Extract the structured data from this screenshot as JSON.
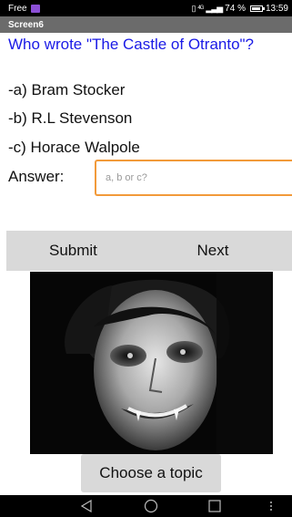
{
  "status_bar": {
    "carrier": "Free",
    "signal_text": "4G",
    "battery_percent": "74 %",
    "battery_level": 0.74,
    "time": "13:59"
  },
  "title_bar": {
    "title": "Screen6"
  },
  "quiz": {
    "question": "Who wrote \"The Castle of Otranto\"?",
    "options": [
      "-a) Bram Stocker",
      "-b) R.L Stevenson",
      "-c) Horace Walpole"
    ],
    "answer_label": "Answer:",
    "answer_placeholder": "a, b or c?",
    "answer_value": ""
  },
  "buttons": {
    "submit": "Submit",
    "next": "Next",
    "choose_topic": "Choose a topic"
  },
  "image": {
    "subject": "vampire-portrait"
  },
  "colors": {
    "question": "#1a1ae6",
    "input_border": "#f29a3a",
    "button_bg": "#d9d9d9",
    "title_bar": "#6b6b6b"
  },
  "nav": {
    "icons": [
      "back-icon",
      "home-icon",
      "recents-icon",
      "menu-icon"
    ]
  }
}
